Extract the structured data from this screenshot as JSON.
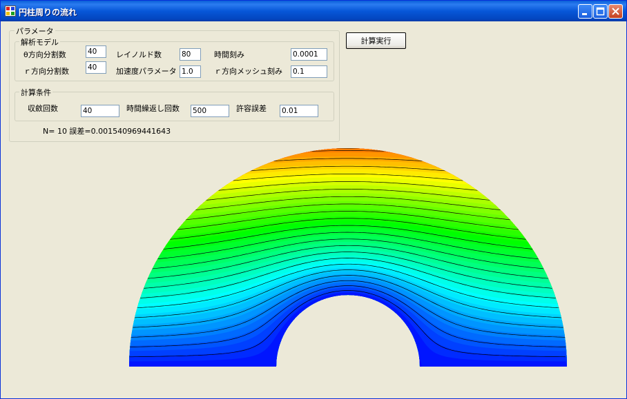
{
  "window": {
    "title": "円柱周りの流れ"
  },
  "params": {
    "legend": "パラメータ",
    "model": {
      "legend": "解析モデル",
      "theta_div_label": "θ方向分割数",
      "theta_div_value": "40",
      "r_div_label": "ｒ方向分割数",
      "r_div_value": "40",
      "reynolds_label": "レイノルド数",
      "reynolds_value": "80",
      "accel_label": "加速度パラメータ",
      "accel_value": "1.0",
      "time_step_label": "時間刻み",
      "time_step_value": "0.0001",
      "r_mesh_label": "ｒ方向メッシュ刻み",
      "r_mesh_value": "0.1"
    },
    "calc": {
      "legend": "計算条件",
      "convergence_label": "収斂回数",
      "convergence_value": "40",
      "repeat_label": "時間繰返し回数",
      "repeat_value": "500",
      "tolerance_label": "許容誤差",
      "tolerance_value": "0.01"
    },
    "status": "N= 10 誤差=0.001540969441643"
  },
  "run_button": {
    "label": "計算実行"
  },
  "plot": {
    "contour_lines": 24,
    "colormap": [
      "#0000ff",
      "#00ffff",
      "#00ff00",
      "#ffff00",
      "#ff0000"
    ]
  }
}
